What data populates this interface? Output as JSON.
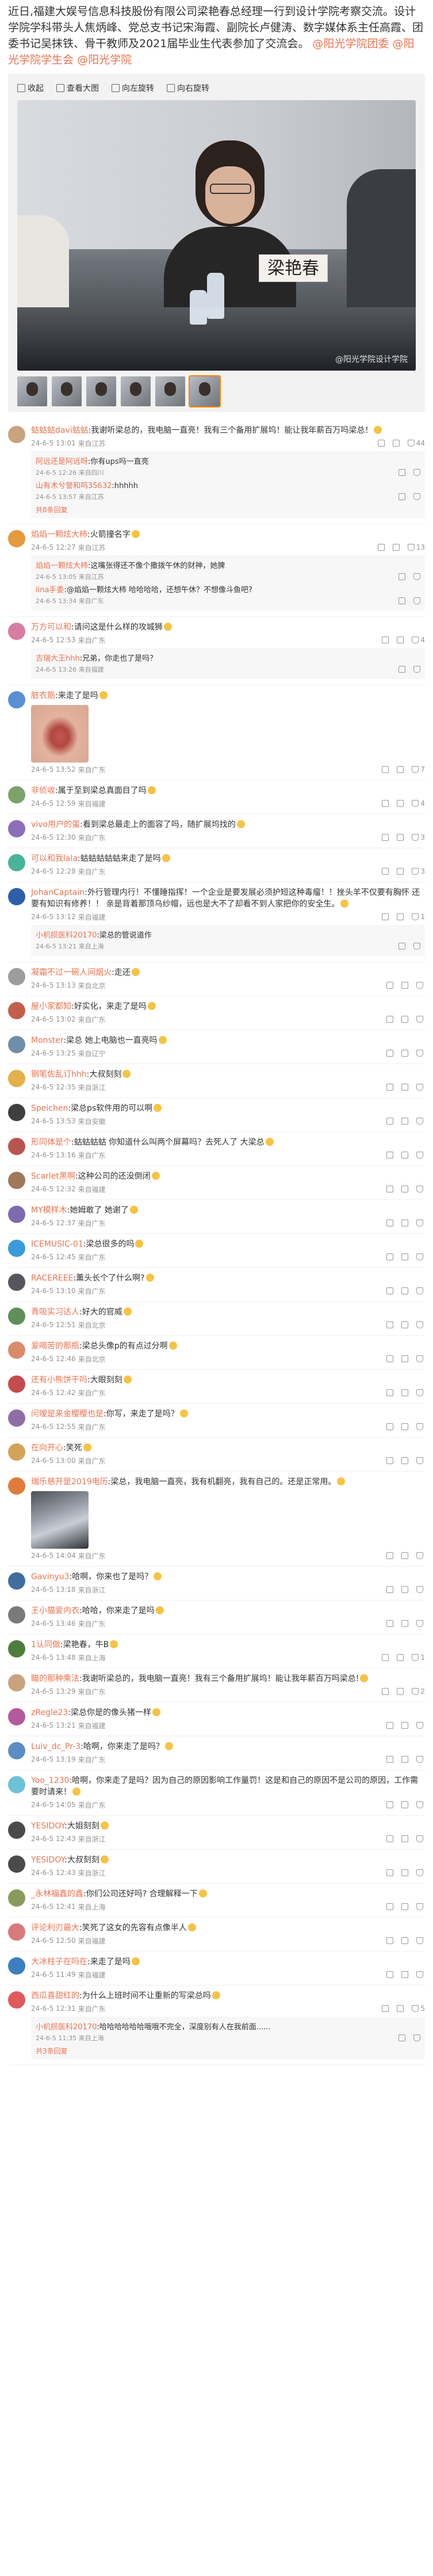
{
  "post": {
    "text_before": "近日,福建大娱号信息科技股份有限公司梁艳春总经理一行到设计学院考察交流。设计学院学科带头人焦炳峰、党总支书记宋海霞、副院长卢健涛、数字媒体系主任高霞、团委书记吴抹铁、骨干教师及2021届毕业生代表参加了交流会。",
    "links": [
      "@阳光学院团委",
      "@阳光学院学生会",
      "@阳光学院"
    ]
  },
  "media": {
    "toolbar": [
      "收起",
      "查看大图",
      "向左旋转",
      "向右旋转"
    ],
    "nameplate": "梁艳春",
    "watermark": "@阳光学院设计学院",
    "thumb_count": 6,
    "active_thumb": 5
  },
  "comments": [
    {
      "name": "蛄蛄蛄davi蛄蛄",
      "text": "我谢听梁总的，我电脑一直亮！我有三个备用扩展坞！能让我年薪百万吗梁总！",
      "time": "24-6-5 13:01",
      "loc": "来自江苏",
      "like": "44",
      "av": "#c9a27e",
      "replies": [
        {
          "name": "阿远还是阿远呀",
          "text": "你有ups吗一直亮",
          "time": "24-6-5 12:26",
          "loc": "来自四川"
        },
        {
          "name": "山有木兮誉和鸣35632",
          "text": "hhhhh",
          "time": "24-6-5 13:57",
          "loc": "来自江苏"
        }
      ],
      "more": "共8条回复"
    },
    {
      "name": "焰焰一颗炫大柿",
      "text": "火箭撞名字",
      "time": "24-6-5 12:27",
      "loc": "来自江苏",
      "like": "13",
      "av": "#e59a3c",
      "replies": [
        {
          "name": "焰焰一颗炫大柿",
          "text": "这嘴张得还不像个撒拨午休的财神，她脾",
          "time": "24-6-5 13:05",
          "loc": "来自江苏"
        },
        {
          "name": "lina手委",
          "text": "@焰焰一颗炫大柿 哈哈哈哈，还想午休？不想像斗鱼吧?",
          "time": "24-6-5 13:34",
          "loc": "来自广东"
        }
      ],
      "more": ""
    },
    {
      "name": "万方可以和",
      "text": "请问这是什么样的攻城狮",
      "time": "24-6-5 12:53",
      "loc": "来自广东",
      "like": "4",
      "av": "#d67da0",
      "replies": [
        {
          "name": "吉瑞大王hhh",
          "text": "兄弟，你走也了是吗？",
          "time": "24-6-5 13:26",
          "loc": "来自福建"
        }
      ],
      "more": ""
    },
    {
      "name": "脏衣筋",
      "text": "来走了是吗",
      "time": "24-6-5 13:52",
      "loc": "来自广东",
      "like": "7",
      "av": "#5a8fd6",
      "img": "lips",
      "replies": [],
      "more": ""
    },
    {
      "name": "非侦收",
      "text": "属于至到梁总真面目了吗",
      "time": "24-6-5 12:59",
      "loc": "来自福建",
      "like": "4",
      "av": "#7aa36b",
      "replies": [],
      "more": ""
    },
    {
      "name": "vivo用户的蛋",
      "text": "看到梁总最走上的面容了吗，随扩展坞找的",
      "time": "24-6-5 12:30",
      "loc": "来自广东",
      "like": "3",
      "av": "#8b6fb8",
      "replies": [],
      "more": ""
    },
    {
      "name": "可以和我lala",
      "text": "蛄蛄蛄蛄蛄来走了是吗",
      "time": "24-6-5 12:28",
      "loc": "来自广东",
      "like": "3",
      "av": "#4bb39a",
      "replies": [],
      "more": ""
    },
    {
      "name": "JohanCaptain",
      "text": "外行管理内行！不懂睡指挥！一个企业是要发展必须护短这种毒瘤！！挫头羊不仅要有胸怀 还要有知识有修养！！ 亲是背着那顶乌纱帽，远也是大不了却看不到人家把你的安全生。",
      "time": "24-6-5 13:12",
      "loc": "来自福建",
      "like": "1",
      "av": "#2d5ea8",
      "replies": [
        {
          "name": "小机损医科20170",
          "text": "梁总的管说道作",
          "time": "24-6-5 13:21",
          "loc": "来自上海"
        }
      ],
      "more": ""
    },
    {
      "name": "凝霜不过一碗人间烟火",
      "text": "走还",
      "time": "24-6-5 13:13",
      "loc": "来自北京",
      "like": "",
      "av": "#9c9c9c",
      "replies": [],
      "more": ""
    },
    {
      "name": "屋小家都知",
      "text": "好实化，来走了是吗",
      "time": "24-6-5 13:02",
      "loc": "来自广东",
      "like": "",
      "av": "#c25f4a",
      "replies": [],
      "more": ""
    },
    {
      "name": "Monster",
      "text": "梁总 她上电脑也一直亮吗",
      "time": "24-6-5 13:25",
      "loc": "来自辽宁",
      "like": "",
      "av": "#6e8fa8",
      "replies": [],
      "more": ""
    },
    {
      "name": "钢笔佐乱订hhh",
      "text": "大叔刻刻",
      "time": "24-6-5 12:35",
      "loc": "来自浙江",
      "like": "",
      "av": "#e3b04b",
      "replies": [],
      "more": ""
    },
    {
      "name": "Speichen",
      "text": "梁总ps软件用的可以啊",
      "time": "24-6-5 13:53",
      "loc": "来自安徽",
      "like": "",
      "av": "#3f3f3f",
      "replies": [],
      "more": ""
    },
    {
      "name": "形同体是个",
      "text": "蛄蛄蛄蛄 你知道什么叫两个屏幕吗？去死人了 大梁总",
      "time": "24-6-5 13:16",
      "loc": "来自广东",
      "like": "",
      "av": "#b8554f",
      "replies": [],
      "more": ""
    },
    {
      "name": "Scarlet黑啊",
      "text": "这种公司的还没倒闭",
      "time": "24-6-5 12:32",
      "loc": "来自福建",
      "like": "",
      "av": "#a0785a",
      "replies": [],
      "more": ""
    },
    {
      "name": "MY模样木",
      "text": "她姆敢了 她谢了",
      "time": "24-6-5 12:37",
      "loc": "来自广东",
      "like": "",
      "av": "#7d6bb0",
      "replies": [],
      "more": ""
    },
    {
      "name": "ICEMUSIC-01",
      "text": "梁总很多的吗",
      "time": "24-6-5 12:45",
      "loc": "来自广东",
      "like": "",
      "av": "#3b9ad9",
      "replies": [],
      "more": ""
    },
    {
      "name": "RACEREEE",
      "text": "薰头长个了什么啊?",
      "time": "24-6-5 13:10",
      "loc": "来自广东",
      "like": "",
      "av": "#56575c",
      "replies": [],
      "more": ""
    },
    {
      "name": "青吸实习达人",
      "text": "好大的官威",
      "time": "24-6-5 12:51",
      "loc": "来自北京",
      "like": "",
      "av": "#5f8f5a",
      "replies": [],
      "more": ""
    },
    {
      "name": "爱喝苦的那瓶",
      "text": "梁总头像p的有点过分啊",
      "time": "24-6-5 12:46",
      "loc": "来自北京",
      "like": "",
      "av": "#d98c6b",
      "replies": [],
      "more": ""
    },
    {
      "name": "还有小熊饼干吗",
      "text": "大眼刻刻",
      "time": "24-6-5 12:42",
      "loc": "来自广东",
      "like": "",
      "av": "#c44c4c",
      "replies": [],
      "more": ""
    },
    {
      "name": "问嗳是来金樱樱也是",
      "text": "你写，来走了是吗？",
      "time": "24-6-5 12:55",
      "loc": "来自广东",
      "like": "",
      "av": "#8f6ea8",
      "replies": [],
      "more": ""
    },
    {
      "name": "在向开心",
      "text": "笑死",
      "time": "24-6-5 13:00",
      "loc": "来自广东",
      "like": "",
      "av": "#d4a35a",
      "replies": [],
      "more": ""
    },
    {
      "name": "瑞乐慈开是2019电历",
      "text": "梁总，我电脑一直亮，我有机翻亮，我有自己的。还是正常用。",
      "time": "24-6-5 14:04",
      "loc": "来自广东",
      "like": "",
      "av": "#e07b3c",
      "img": "car",
      "replies": [],
      "more": ""
    },
    {
      "name": "Gavinyu3",
      "text": "哈啊，你来也了是吗？",
      "time": "24-6-5 13:18",
      "loc": "来自浙江",
      "like": "",
      "av": "#3f6d9e",
      "replies": [],
      "more": ""
    },
    {
      "name": "王小猫爱内衣",
      "text": "哈哈，你来走了是吗",
      "time": "24-6-5 13:46",
      "loc": "来自广东",
      "like": "",
      "av": "#7a7a7a",
      "replies": [],
      "more": ""
    },
    {
      "name": "1认同做",
      "text": "梁艳春，牛B",
      "time": "24-6-5 13:48",
      "loc": "来自上海",
      "like": "1",
      "av": "#4e7d3b",
      "replies": [],
      "more": ""
    },
    {
      "name": "瞄的那种乘法",
      "text": "我谢听梁总的，我电脑一直亮！我有三个备用扩展坞！能让我年薪百万吗梁总!",
      "time": "24-6-5 13:29",
      "loc": "来自广东",
      "like": "2",
      "av": "#c9a27e",
      "replies": [],
      "more": ""
    },
    {
      "name": "zRegle23",
      "text": "梁总你是的像头猪一样",
      "time": "24-6-5 13:21",
      "loc": "来自福建",
      "like": "",
      "av": "#b35a9d",
      "replies": [],
      "more": ""
    },
    {
      "name": "Luiv_dc_Pr-3",
      "text": "哈啊，你来走了是吗？",
      "time": "24-6-5 13:19",
      "loc": "来自广东",
      "like": "",
      "av": "#5b8cc4",
      "replies": [],
      "more": ""
    },
    {
      "name": "Yoo_1230",
      "text": "哈啊，你来走了是吗？因为自己的原因影响工作量罚！这是和自己的原因不是公司的原因，工作需要时请来！",
      "time": "24-6-5 14:05",
      "loc": "来自广东",
      "like": "",
      "av": "#6ec2d8",
      "replies": [],
      "more": ""
    },
    {
      "name": "YESIDOY",
      "text": "大姐刻刻",
      "time": "24-6-5 12:43",
      "loc": "来自浙江",
      "like": "",
      "av": "#4a4a4a",
      "replies": [],
      "more": ""
    },
    {
      "name": "YESIDOY",
      "text": "大叔刻刻",
      "time": "24-6-5 12:43",
      "loc": "来自浙江",
      "like": "",
      "av": "#4a4a4a",
      "replies": [],
      "more": ""
    },
    {
      "name": "_永林福鑫的鑫",
      "text": "你们公司还好吗? 合理解释一下",
      "time": "24-6-5 12:41",
      "loc": "来自上海",
      "like": "",
      "av": "#8a9a5b",
      "replies": [],
      "more": ""
    },
    {
      "name": "评论利刃最大",
      "text": "笑死了这女的先容有点像半人",
      "time": "24-6-5 12:50",
      "loc": "来自福建",
      "like": "",
      "av": "#d97a7a",
      "replies": [],
      "more": ""
    },
    {
      "name": "大冰柱子在吗在",
      "text": "来走了是吗",
      "time": "24-6-5 11:49",
      "loc": "来自福建",
      "like": "",
      "av": "#3c7ebf",
      "replies": [],
      "more": ""
    },
    {
      "name": "西瓜喜甜红的",
      "text": "为什么上班时间不让重新的写梁总吗",
      "time": "24-6-5 12:31",
      "loc": "来自广东",
      "like": "5",
      "av": "#e05a5a",
      "replies": [
        {
          "name": "小机损医科20170",
          "text": "哈哈哈哈哈哈哦哦不完全，深度别有人在我前面......",
          "time": "24-6-5 11:35",
          "loc": "来自上海"
        }
      ],
      "more": "共3条回复"
    }
  ]
}
